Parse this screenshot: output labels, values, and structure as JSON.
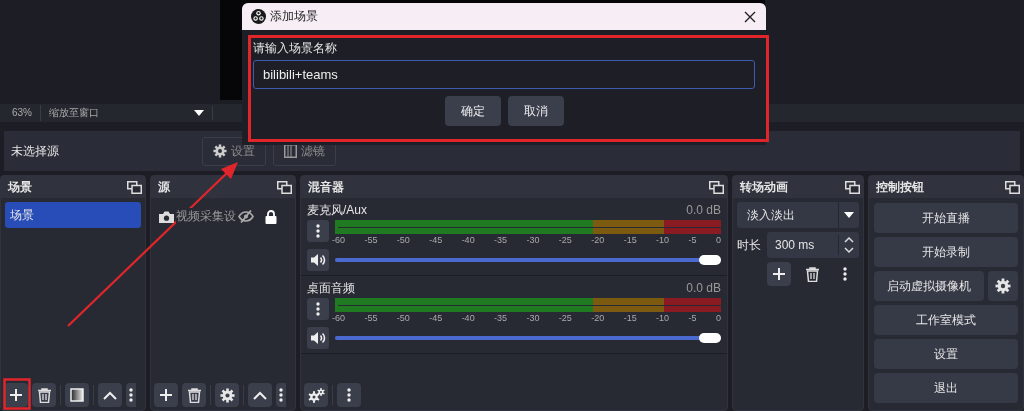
{
  "preview": {
    "zoom": "63%",
    "scale_mode": "缩放至窗口"
  },
  "source_toolbar": {
    "status": "未选择源",
    "buttons": [
      {
        "label": "设置",
        "kind": "settings",
        "disabled": true
      },
      {
        "label": "滤镜",
        "kind": "filters",
        "disabled": true
      }
    ]
  },
  "scenes": {
    "title": "场景",
    "items": [
      {
        "label": "场景",
        "selected": true
      }
    ]
  },
  "sources": {
    "title": "源",
    "items": [
      {
        "label": "视频采集设",
        "visible": false,
        "locked": true
      }
    ]
  },
  "mixer": {
    "title": "混音器",
    "channels": [
      {
        "name": "麦克风/Aux",
        "reading": "0.0 dB",
        "level": 1,
        "scale": [
          "-60",
          "-55",
          "-50",
          "-45",
          "-40",
          "-35",
          "-30",
          "-25",
          "-20",
          "-15",
          "-10",
          "-5",
          "0"
        ]
      },
      {
        "name": "桌面音频",
        "reading": "0.0 dB",
        "level": 1,
        "scale": [
          "-60",
          "-55",
          "-50",
          "-45",
          "-40",
          "-35",
          "-30",
          "-25",
          "-20",
          "-15",
          "-10",
          "-5",
          "0"
        ]
      }
    ]
  },
  "transitions": {
    "title": "转场动画",
    "transition": "淡入淡出",
    "duration_label": "时长",
    "duration": "300 ms"
  },
  "controls": {
    "title": "控制按钮",
    "buttons": [
      {
        "label": "开始直播",
        "kind": "plain"
      },
      {
        "label": "开始录制",
        "kind": "plain"
      },
      {
        "label": "启动虚拟摄像机",
        "kind": "with-settings"
      },
      {
        "label": "工作室模式",
        "kind": "plain"
      },
      {
        "label": "设置",
        "kind": "plain"
      },
      {
        "label": "退出",
        "kind": "plain"
      }
    ]
  },
  "dialog": {
    "title": "添加场景",
    "prompt": "请输入场景名称",
    "value": "bilibili+teams",
    "buttons": [
      "确定",
      "取消"
    ]
  }
}
